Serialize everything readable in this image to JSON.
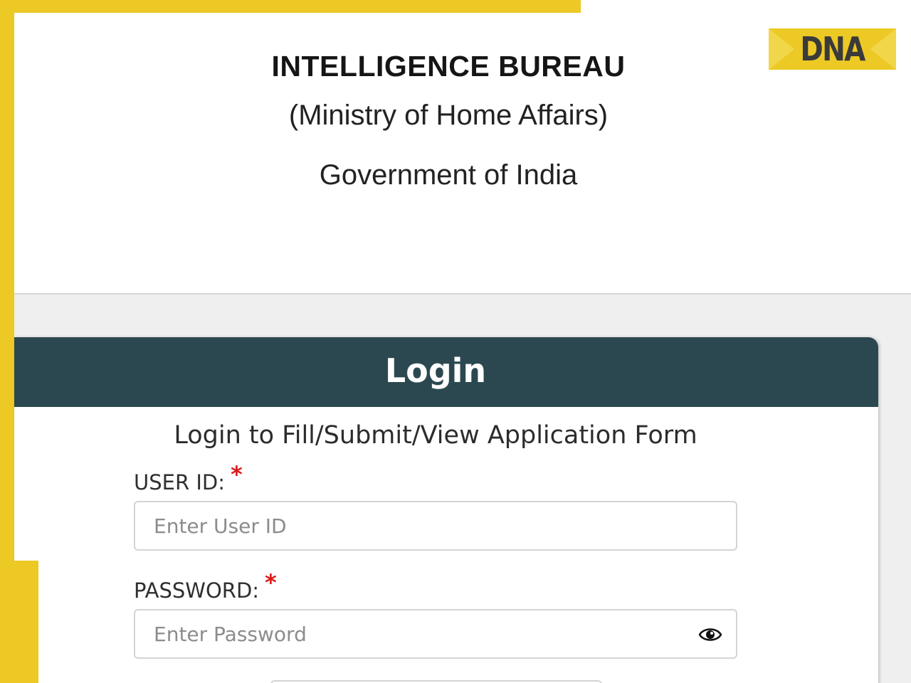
{
  "header": {
    "title": "INTELLIGENCE BUREAU",
    "ministry": "(Ministry of Home Affairs)",
    "government": "Government of India"
  },
  "logo": {
    "text": "DNA",
    "background": "#ecc924"
  },
  "login": {
    "title": "Login",
    "subtitle": "Login to Fill/Submit/View Application Form",
    "user_id": {
      "label": "USER ID:",
      "required_mark": "*",
      "placeholder": "Enter User ID",
      "value": ""
    },
    "password": {
      "label": "PASSWORD:",
      "required_mark": "*",
      "placeholder": "Enter Password",
      "value": "",
      "toggle_icon": "eye-icon"
    }
  },
  "colors": {
    "frame": "#ecc924",
    "card_header": "#2b4850",
    "required": "#e01a1a"
  }
}
